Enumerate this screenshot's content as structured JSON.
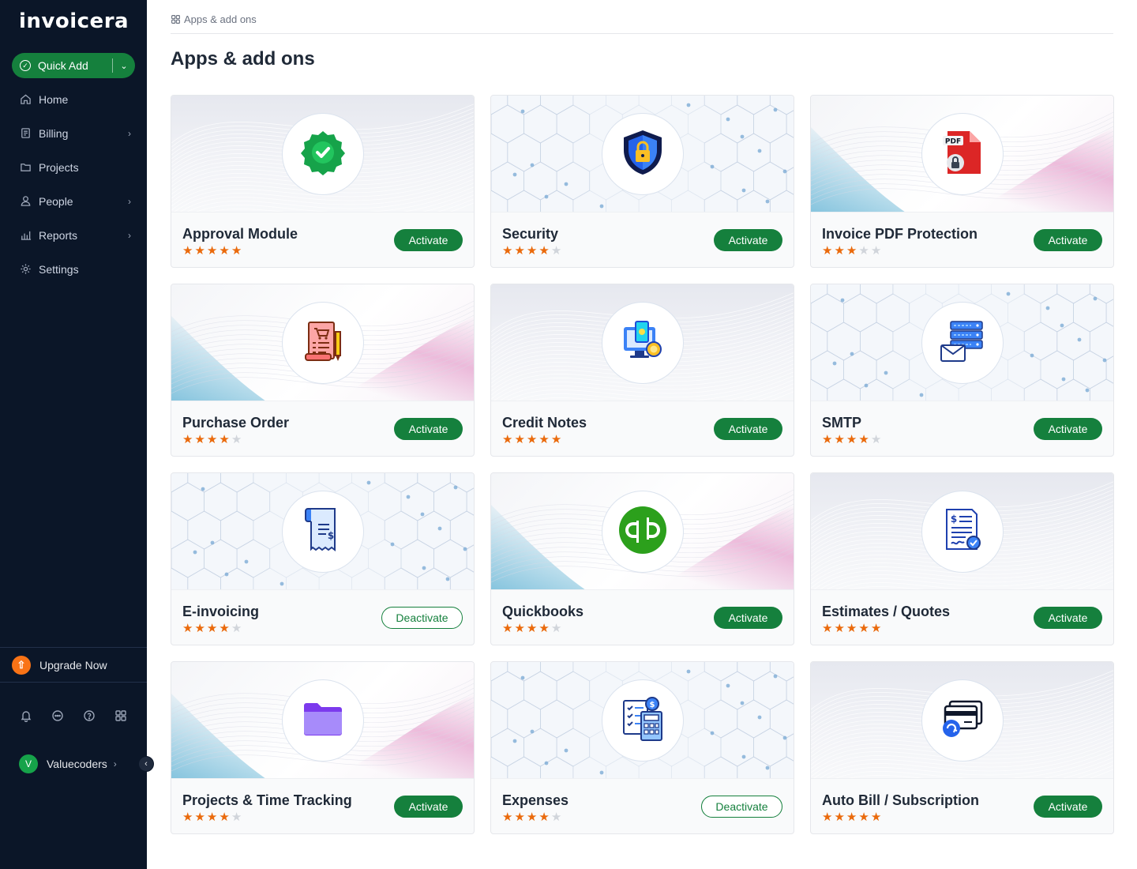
{
  "app": {
    "logo": "invoicera"
  },
  "sidebar": {
    "quick_add": "Quick Add",
    "items": [
      {
        "label": "Home",
        "icon": "home-icon",
        "has_submenu": false
      },
      {
        "label": "Billing",
        "icon": "receipt-icon",
        "has_submenu": true
      },
      {
        "label": "Projects",
        "icon": "folder-icon",
        "has_submenu": false
      },
      {
        "label": "People",
        "icon": "user-icon",
        "has_submenu": true
      },
      {
        "label": "Reports",
        "icon": "bar-chart-icon",
        "has_submenu": true
      },
      {
        "label": "Settings",
        "icon": "gear-icon",
        "has_submenu": false
      }
    ],
    "upgrade": "Upgrade Now",
    "footer_icons": [
      "bell-icon",
      "chat-icon",
      "help-icon",
      "apps-icon"
    ],
    "user": {
      "initial": "V",
      "name": "Valuecoders"
    }
  },
  "breadcrumb": "Apps & add ons",
  "page_title": "Apps & add ons",
  "apps": [
    {
      "name": "Approval Module",
      "rating": 5,
      "action": "Activate",
      "icon": "approval-badge-icon",
      "bg": "wave"
    },
    {
      "name": "Security",
      "rating": 4,
      "action": "Activate",
      "icon": "security-shield-icon",
      "bg": "hex"
    },
    {
      "name": "Invoice PDF Protection",
      "rating": 3,
      "action": "Activate",
      "icon": "pdf-lock-icon",
      "bg": "grad"
    },
    {
      "name": "Purchase Order",
      "rating": 4,
      "action": "Activate",
      "icon": "purchase-order-icon",
      "bg": "grad"
    },
    {
      "name": "Credit Notes",
      "rating": 5,
      "action": "Activate",
      "icon": "credit-notes-icon",
      "bg": "wave"
    },
    {
      "name": "SMTP",
      "rating": 4,
      "action": "Activate",
      "icon": "smtp-server-icon",
      "bg": "hex"
    },
    {
      "name": "E-invoicing",
      "rating": 4,
      "action": "Deactivate",
      "icon": "e-invoice-icon",
      "bg": "hex"
    },
    {
      "name": "Quickbooks",
      "rating": 4,
      "action": "Activate",
      "icon": "quickbooks-icon",
      "bg": "grad"
    },
    {
      "name": "Estimates / Quotes",
      "rating": 5,
      "action": "Activate",
      "icon": "estimate-doc-icon",
      "bg": "wave"
    },
    {
      "name": "Projects & Time Tracking",
      "rating": 4,
      "action": "Activate",
      "icon": "purple-folder-icon",
      "bg": "grad"
    },
    {
      "name": "Expenses",
      "rating": 4,
      "action": "Deactivate",
      "icon": "expenses-calculator-icon",
      "bg": "hex"
    },
    {
      "name": "Auto Bill / Subscription",
      "rating": 5,
      "action": "Activate",
      "icon": "auto-bill-card-icon",
      "bg": "wave"
    }
  ],
  "colors": {
    "sidebar_bg": "#0b1628",
    "primary_green": "#15803d",
    "star": "#ea6a0c",
    "upgrade_orange": "#f97316"
  }
}
